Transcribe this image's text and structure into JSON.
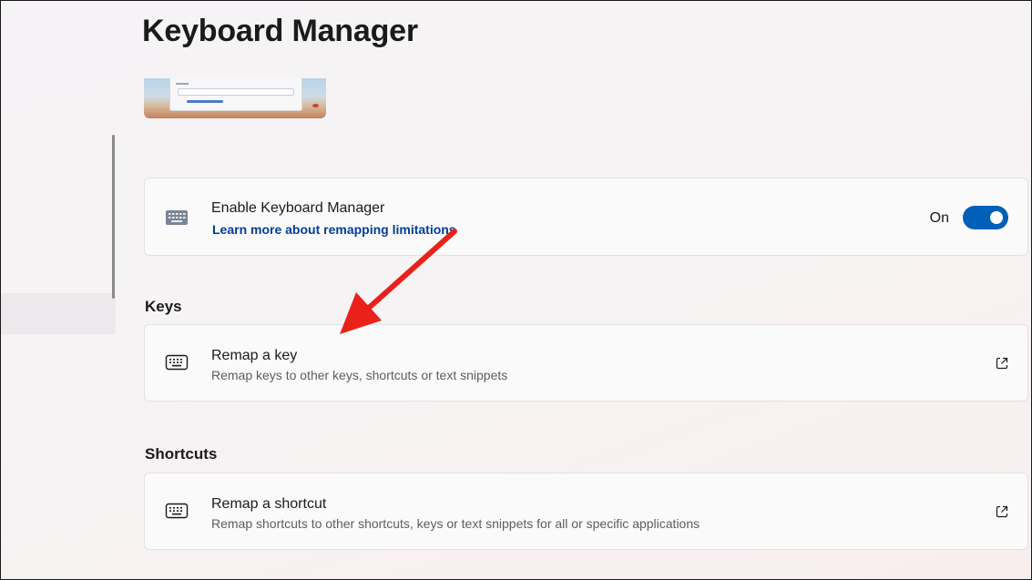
{
  "page": {
    "title": "Keyboard Manager"
  },
  "enable_card": {
    "title": "Enable Keyboard Manager",
    "link_text": "Learn more about remapping limitations",
    "toggle_label": "On",
    "toggle_on": true,
    "icon": "keyboard-icon"
  },
  "sections": {
    "keys_heading": "Keys",
    "shortcuts_heading": "Shortcuts"
  },
  "remap_key_card": {
    "title": "Remap a key",
    "description": "Remap keys to other keys, shortcuts or text snippets",
    "icon": "keyboard-icon",
    "action_icon": "open-external-icon"
  },
  "remap_shortcut_card": {
    "title": "Remap a shortcut",
    "description": "Remap shortcuts to other shortcuts, keys or text snippets for all or specific applications",
    "icon": "keyboard-icon",
    "action_icon": "open-external-icon"
  },
  "colors": {
    "accent": "#005fb8",
    "link": "#003e92",
    "annotation_arrow": "#e8221b"
  }
}
